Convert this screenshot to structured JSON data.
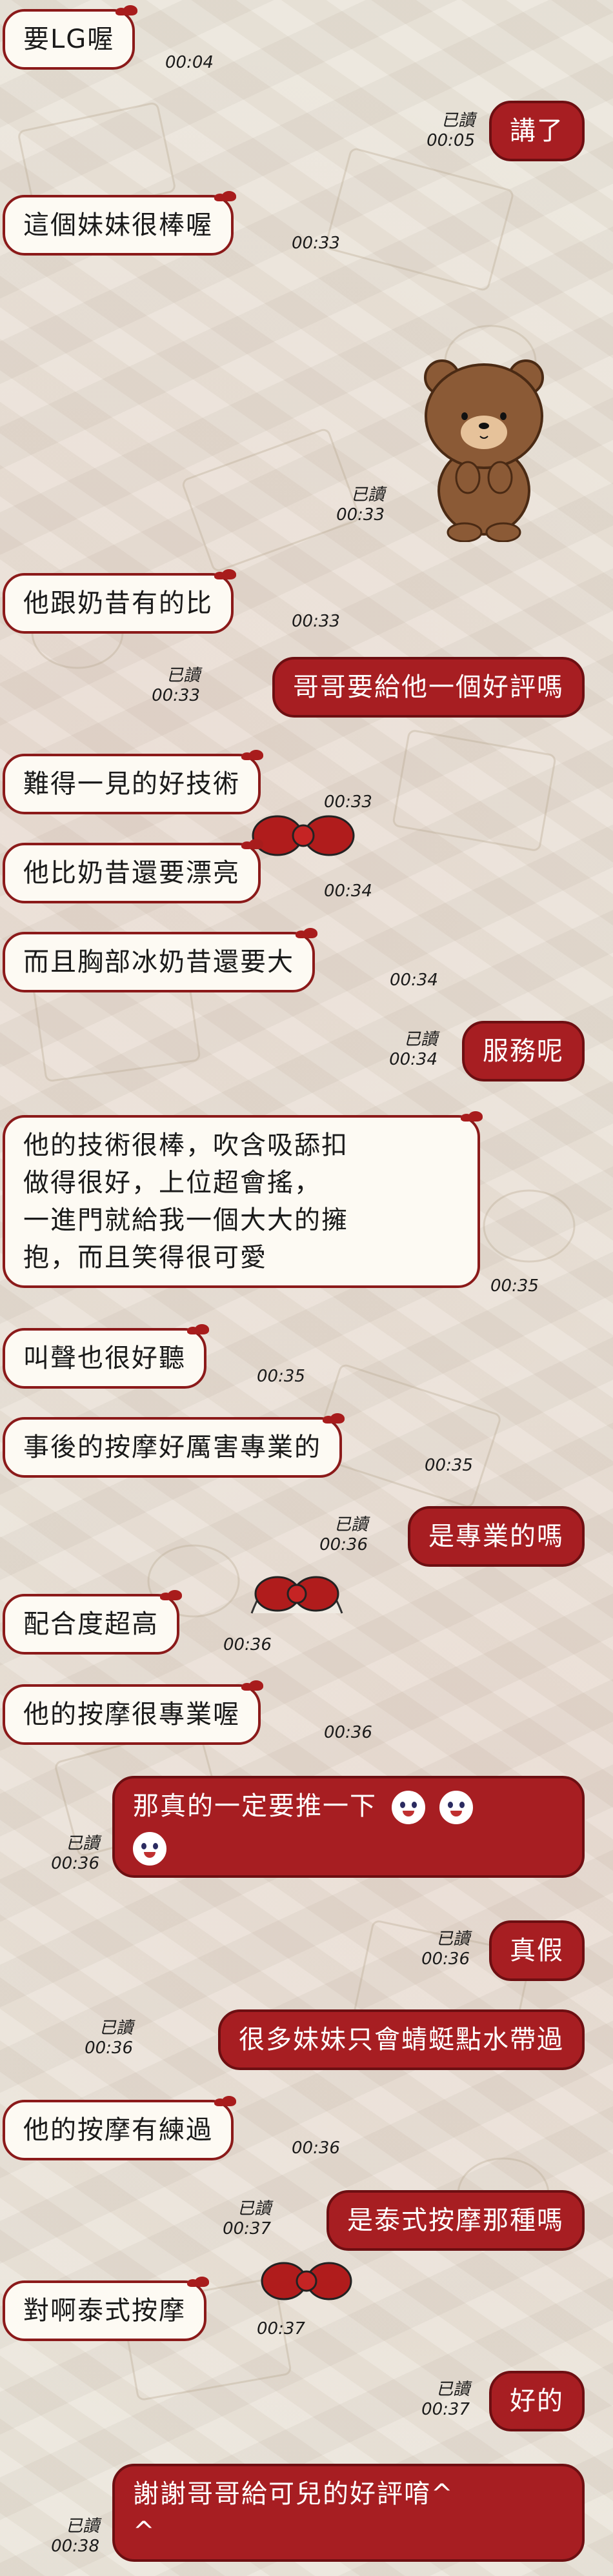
{
  "messages": [
    {
      "id": "m1",
      "side": "recv",
      "text": "要LG喔",
      "time": "00:04"
    },
    {
      "id": "m2",
      "side": "sent",
      "text": "講了",
      "read": "已讀",
      "time": "00:05"
    },
    {
      "id": "m3",
      "side": "recv",
      "text": "這個妹妹很棒喔",
      "time": "00:33"
    },
    {
      "id": "m4",
      "side": "sent",
      "type": "sticker",
      "sticker": "brown-bear-sticker",
      "read": "已讀",
      "time": "00:33"
    },
    {
      "id": "m5",
      "side": "recv",
      "text": "他跟奶昔有的比",
      "time": "00:33"
    },
    {
      "id": "m6",
      "side": "sent",
      "text": "哥哥要給他一個好評嗎",
      "read": "已讀",
      "time": "00:33"
    },
    {
      "id": "m7",
      "side": "recv",
      "text": "難得一見的好技術",
      "time": "00:33"
    },
    {
      "id": "m8",
      "side": "recv",
      "text": "他比奶昔還要漂亮",
      "time": "00:34"
    },
    {
      "id": "m9",
      "side": "recv",
      "text": "而且胸部冰奶昔還要大",
      "time": "00:34"
    },
    {
      "id": "m10",
      "side": "sent",
      "text": "服務呢",
      "read": "已讀",
      "time": "00:34"
    },
    {
      "id": "m11",
      "side": "recv",
      "lines": [
        "他的技術很棒，吹含吸舔扣",
        "做得很好，上位超會搖，",
        "一進門就給我一個大大的擁",
        "抱，而且笑得很可愛"
      ],
      "time": "00:35"
    },
    {
      "id": "m12",
      "side": "recv",
      "text": "叫聲也很好聽",
      "time": "00:35"
    },
    {
      "id": "m13",
      "side": "recv",
      "text": "事後的按摩好厲害專業的",
      "time": "00:35"
    },
    {
      "id": "m14",
      "side": "sent",
      "text": "是專業的嗎",
      "read": "已讀",
      "time": "00:36"
    },
    {
      "id": "m15",
      "side": "recv",
      "text": "配合度超高",
      "time": "00:36"
    },
    {
      "id": "m16",
      "side": "recv",
      "text": "他的按摩很專業喔",
      "time": "00:36"
    },
    {
      "id": "m17",
      "side": "sent",
      "text": "那真的一定要推一下",
      "read": "已讀",
      "time": "00:36",
      "emoji": [
        "smile-emoji",
        "smile-emoji",
        "smile-emoji"
      ]
    },
    {
      "id": "m18",
      "side": "sent",
      "text": "真假",
      "read": "已讀",
      "time": "00:36"
    },
    {
      "id": "m19",
      "side": "sent",
      "text": "很多妹妹只會蜻蜓點水帶過",
      "read": "已讀",
      "time": "00:36"
    },
    {
      "id": "m20",
      "side": "recv",
      "text": "他的按摩有練過",
      "time": "00:36"
    },
    {
      "id": "m21",
      "side": "sent",
      "text": "是泰式按摩那種嗎",
      "read": "已讀",
      "time": "00:37"
    },
    {
      "id": "m22",
      "side": "recv",
      "text": "對啊泰式按摩",
      "time": "00:37"
    },
    {
      "id": "m23",
      "side": "sent",
      "text": "好的",
      "read": "已讀",
      "time": "00:37"
    },
    {
      "id": "m24",
      "side": "sent",
      "lines": [
        "謝謝哥哥給可兒的好評唷^",
        "^"
      ],
      "read": "已讀",
      "time": "00:38"
    }
  ],
  "colors": {
    "sent_bg": "#a71e22",
    "recv_bg": "#fdfaf3",
    "recv_border": "#8b1a1a",
    "background": "#ebe6dc"
  }
}
